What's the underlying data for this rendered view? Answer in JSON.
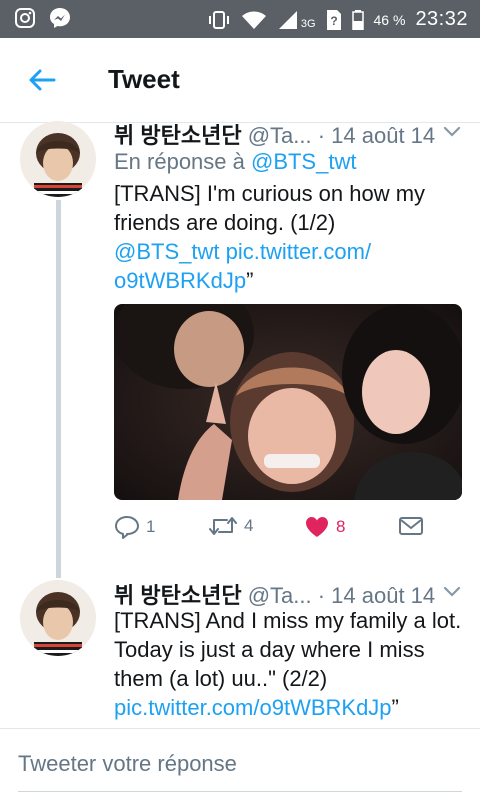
{
  "status_bar": {
    "battery": "46 %",
    "network": "3G",
    "time": "23:32",
    "icons": [
      "instagram-icon",
      "messenger-icon",
      "vibrate-icon",
      "wifi-icon",
      "signal-icon",
      "sim-unknown-icon",
      "battery-icon"
    ]
  },
  "app_bar": {
    "title": "Tweet"
  },
  "tweets": [
    {
      "name": "뷔 방탄소년단",
      "handle": "@Ta...",
      "date": "· 14 août 14",
      "reply_prefix": "En réponse à ",
      "reply_handle": "@BTS_twt",
      "text_line1": "[TRANS] I'm curious on how my",
      "text_line2": "friends are doing. (1/2)",
      "mention": "@BTS_twt",
      "link1": "pic.twitter.com/",
      "link2": "o9tWBRKdJp",
      "quote_end": "”",
      "replies": "1",
      "retweets": "4",
      "likes": "8",
      "liked": true
    },
    {
      "name": "뷔 방탄소년단",
      "handle": "@Ta...",
      "date": "· 14 août 14",
      "text_line1": "[TRANS] And I miss my family a lot.",
      "text_line2": "Today is just a day where I miss",
      "text_line3": "them (a lot) uu..\" (2/2)",
      "link": "pic.twitter.com/o9tWBRKdJp",
      "quote_end": "”"
    }
  ],
  "composer": {
    "placeholder": "Tweeter votre réponse"
  },
  "colors": {
    "link": "#1da1f2",
    "like": "#e0245e",
    "muted": "#657786",
    "status_bar": "#5a6066"
  }
}
